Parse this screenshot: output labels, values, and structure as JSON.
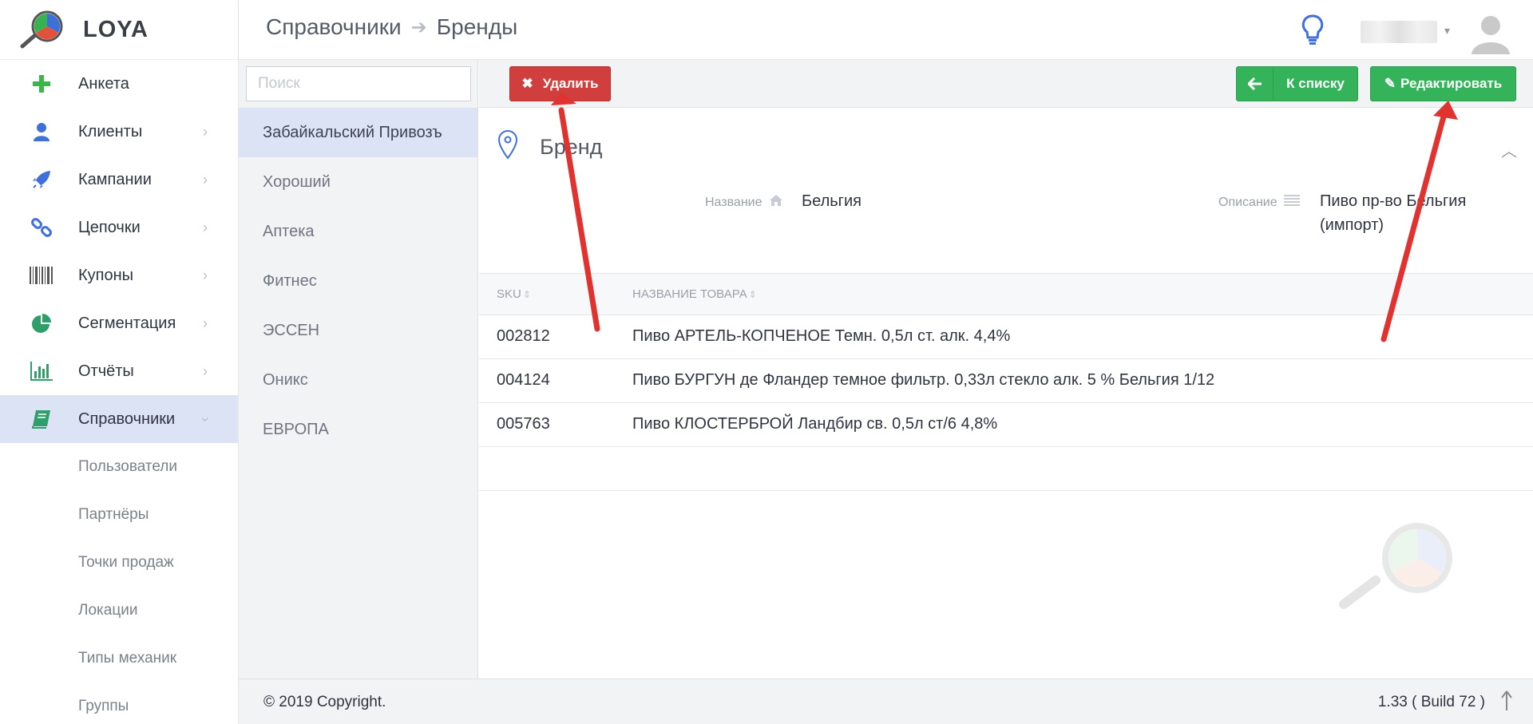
{
  "app": {
    "logo_text": "LOYA"
  },
  "header": {
    "breadcrumb_parent": "Справочники",
    "breadcrumb_current": "Бренды"
  },
  "sidebar": {
    "items": [
      {
        "label": "Анкета",
        "icon": "plus-icon",
        "has_chevron": false
      },
      {
        "label": "Клиенты",
        "icon": "user-icon",
        "has_chevron": true
      },
      {
        "label": "Кампании",
        "icon": "rocket-icon",
        "has_chevron": true
      },
      {
        "label": "Цепочки",
        "icon": "link-icon",
        "has_chevron": true
      },
      {
        "label": "Купоны",
        "icon": "barcode-icon",
        "has_chevron": true
      },
      {
        "label": "Сегментация",
        "icon": "pie-chart-icon",
        "has_chevron": true
      },
      {
        "label": "Отчёты",
        "icon": "bar-chart-icon",
        "has_chevron": true
      },
      {
        "label": "Справочники",
        "icon": "book-icon",
        "has_chevron": true,
        "active": true
      }
    ],
    "subitems": [
      {
        "label": "Пользователи"
      },
      {
        "label": "Партнёры"
      },
      {
        "label": "Точки продаж"
      },
      {
        "label": "Локации"
      },
      {
        "label": "Типы механик"
      },
      {
        "label": "Группы"
      }
    ]
  },
  "list": {
    "search_placeholder": "Поиск",
    "items": [
      {
        "label": "Забайкальский Привозъ",
        "active": true
      },
      {
        "label": "Хороший"
      },
      {
        "label": "Аптека"
      },
      {
        "label": "Фитнес"
      },
      {
        "label": "ЭССЕН"
      },
      {
        "label": "Оникс"
      },
      {
        "label": "ЕВРОПА"
      }
    ]
  },
  "toolbar": {
    "delete_label": "Удалить",
    "back_label": "К списку",
    "edit_label": "Редактировать"
  },
  "brand": {
    "section_title": "Бренд",
    "name_label": "Название",
    "name_value": "Бельгия",
    "description_label": "Описание",
    "description_value": "Пиво пр-во Бельгия (импорт)"
  },
  "table": {
    "columns": [
      "SKU",
      "НАЗВАНИЕ ТОВАРА"
    ],
    "rows": [
      {
        "sku": "002812",
        "name": "Пиво АРТЕЛЬ-КОПЧЕНОЕ Темн. 0,5л ст. алк. 4,4%"
      },
      {
        "sku": "004124",
        "name": "Пиво БУРГУН де Фландер темное фильтр. 0,33л стекло алк. 5 % Бельгия 1/12"
      },
      {
        "sku": "005763",
        "name": "Пиво КЛОСТЕРБРОЙ Ландбир св. 0,5л ст/6 4,8%"
      }
    ]
  },
  "footer": {
    "copyright": "© 2019 Copyright.",
    "build": "1.33 ( Build 72 )"
  },
  "colors": {
    "accent_blue": "#3f6fd8",
    "green": "#35b35a",
    "red": "#d03e3e",
    "active_bg": "#dbe3f4",
    "arrow_red": "#e0332f"
  }
}
